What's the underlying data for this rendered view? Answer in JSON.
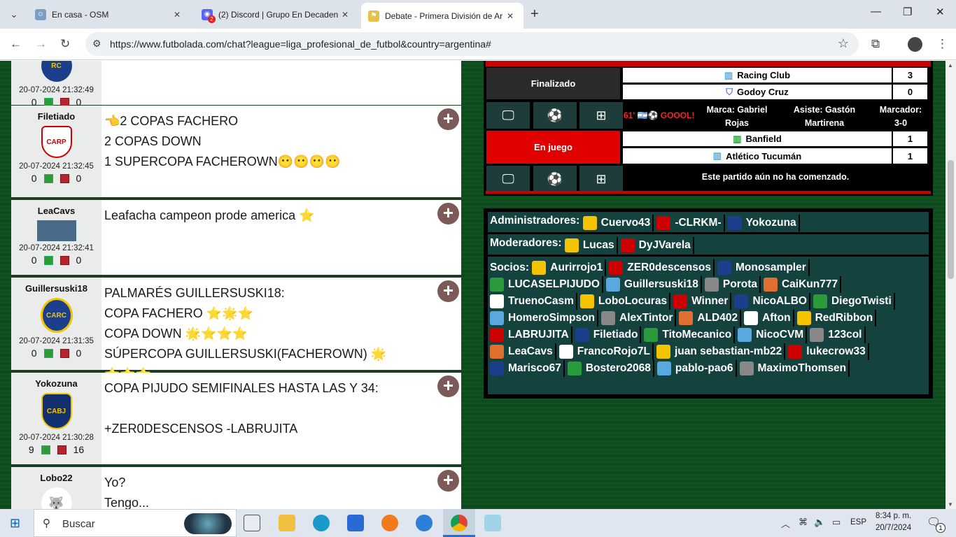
{
  "browser": {
    "tabs": [
      {
        "title": "En casa - OSM",
        "active": false
      },
      {
        "title": "(2) Discord | Grupo En Decaden",
        "active": false
      },
      {
        "title": "Debate - Primera División de Ar",
        "active": true
      }
    ],
    "url": "https://www.futbolada.com/chat?league=liga_profesional_de_futbol&country=argentina#",
    "badge": "2"
  },
  "posts": [
    {
      "user": "",
      "date": "20-07-2024 21:32:49",
      "up": "0",
      "down": "0",
      "text": ""
    },
    {
      "user": "Filetiado",
      "date": "20-07-2024 21:32:45",
      "up": "0",
      "down": "0",
      "text": "👈2 COPAS FACHERO\n2 COPAS DOWN\n1 SUPERCOPA FACHEROWN😶😶😶😶"
    },
    {
      "user": "LeaCavs",
      "date": "20-07-2024 21:32:41",
      "up": "0",
      "down": "0",
      "text": "Leafacha campeon prode america ⭐"
    },
    {
      "user": "Guillersuski18",
      "date": "20-07-2024 21:31:35",
      "up": "0",
      "down": "0",
      "text": "PALMARÉS GUILLERSUSKI18:\nCOPA FACHERO ⭐🌟⭐\nCOPA DOWN 🌟⭐⭐⭐\nSÚPERCOPA GUILLERSUSKI(FACHEROWN) 🌟⭐⭐⭐"
    },
    {
      "user": "Yokozuna",
      "date": "20-07-2024 21:30:28",
      "up": "9",
      "down": "16",
      "text": "COPA PIJUDO SEMIFINALES HASTA LAS Y 34:\n\n+ZER0DESCENSOS -LABRUJITA"
    },
    {
      "user": "Lobo22",
      "date": "",
      "up": "",
      "down": "",
      "text": "Yo?\nTengo..."
    }
  ],
  "matches": [
    {
      "status": "Finalizado",
      "home": "Racing Club",
      "home_score": "3",
      "away": "Godoy Cruz",
      "away_score": "0",
      "event": "61' 🇦🇷⚽ GOOOL!",
      "marca": "Marca: Gabriel Rojas",
      "asiste": "Asiste: Gastón Martirena",
      "marcador": "Marcador: 3-0"
    },
    {
      "status": "En juego",
      "home": "Banfield",
      "home_score": "1",
      "away": "Atlético Tucumán",
      "away_score": "1",
      "note": "Este partido aún no ha comenzado."
    }
  ],
  "roles": {
    "admins_label": "Administradores:",
    "admins": [
      "Cuervo43",
      "-CLRKM-",
      "Yokozuna"
    ],
    "mods_label": "Moderadores:",
    "mods": [
      "Lucas",
      "DyJVarela"
    ],
    "socios_label": "Socios:",
    "socios": [
      "Aurirrojo1",
      "ZER0descensos",
      "Monosampler",
      "LUCASELPIJUDO",
      "Guillersuski18",
      "Porota",
      "CaiKun777",
      "TruenoCasm",
      "LoboLocuras",
      "Winner",
      "NicoALBO",
      "DiegoTwisti",
      "HomeroSimpson",
      "AlexTintor",
      "ALD402",
      "Afton",
      "RedRibbon",
      "LABRUJITA",
      "Filetiado",
      "TitoMecanico",
      "NicoCVM",
      "123col",
      "LeaCavs",
      "FrancoRojo7L",
      "juan sebastian-mb22",
      "lukecrow33",
      "Marisco67",
      "Bostero2068",
      "pablo-pao6",
      "MaximoThomsen"
    ]
  },
  "taskbar": {
    "search": "Buscar",
    "lang": "ESP",
    "time": "8:34 p. m.",
    "date": "20/7/2024",
    "notif": "1"
  }
}
